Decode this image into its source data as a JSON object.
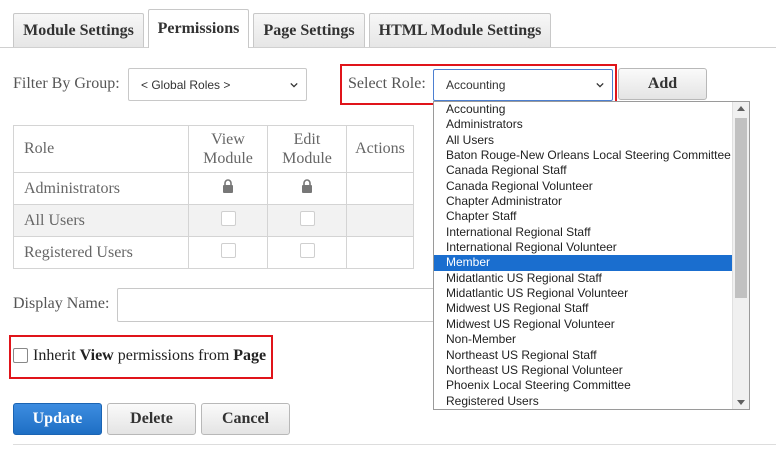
{
  "tabs": [
    {
      "label": "Module Settings",
      "active": false
    },
    {
      "label": "Permissions",
      "active": true
    },
    {
      "label": "Page Settings",
      "active": false
    },
    {
      "label": "HTML Module Settings",
      "active": false
    }
  ],
  "filter": {
    "label": "Filter By Group:",
    "value": "< Global Roles >"
  },
  "role_select": {
    "label": "Select Role:",
    "value": "Accounting"
  },
  "add_button": "Add",
  "table": {
    "headers": {
      "role": "Role",
      "view_line1": "View",
      "view_line2": "Module",
      "edit_line1": "Edit",
      "edit_line2": "Module",
      "actions": "Actions"
    },
    "rows": [
      {
        "role": "Administrators",
        "view": "locked",
        "edit": "locked"
      },
      {
        "role": "All Users",
        "view": "unchecked",
        "edit": "unchecked"
      },
      {
        "role": "Registered Users",
        "view": "unchecked",
        "edit": "unchecked"
      }
    ]
  },
  "display_name": {
    "label": "Display Name:",
    "value": ""
  },
  "inherit": {
    "text1": "Inherit ",
    "bold1": "View",
    "text2": " permissions from ",
    "bold2": "Page",
    "checked": false
  },
  "buttons": {
    "update": "Update",
    "delete": "Delete",
    "cancel": "Cancel"
  },
  "dropdown": {
    "selected": "Member",
    "options": [
      "Accounting",
      "Administrators",
      "All Users",
      "Baton Rouge-New Orleans Local Steering Committee",
      "Canada Regional Staff",
      "Canada Regional Volunteer",
      "Chapter Administrator",
      "Chapter Staff",
      "International Regional Staff",
      "International Regional Volunteer",
      "Member",
      "Midatlantic US Regional Staff",
      "Midatlantic US Regional Volunteer",
      "Midwest US Regional Staff",
      "Midwest US Regional Volunteer",
      "Non-Member",
      "Northeast US Regional Staff",
      "Northeast US Regional Volunteer",
      "Phoenix Local Steering Committee",
      "Registered Users"
    ]
  },
  "colors": {
    "highlight": "#e0141a",
    "selected_option": "#1a6ecf",
    "primary_button": "#1e6fc4"
  }
}
